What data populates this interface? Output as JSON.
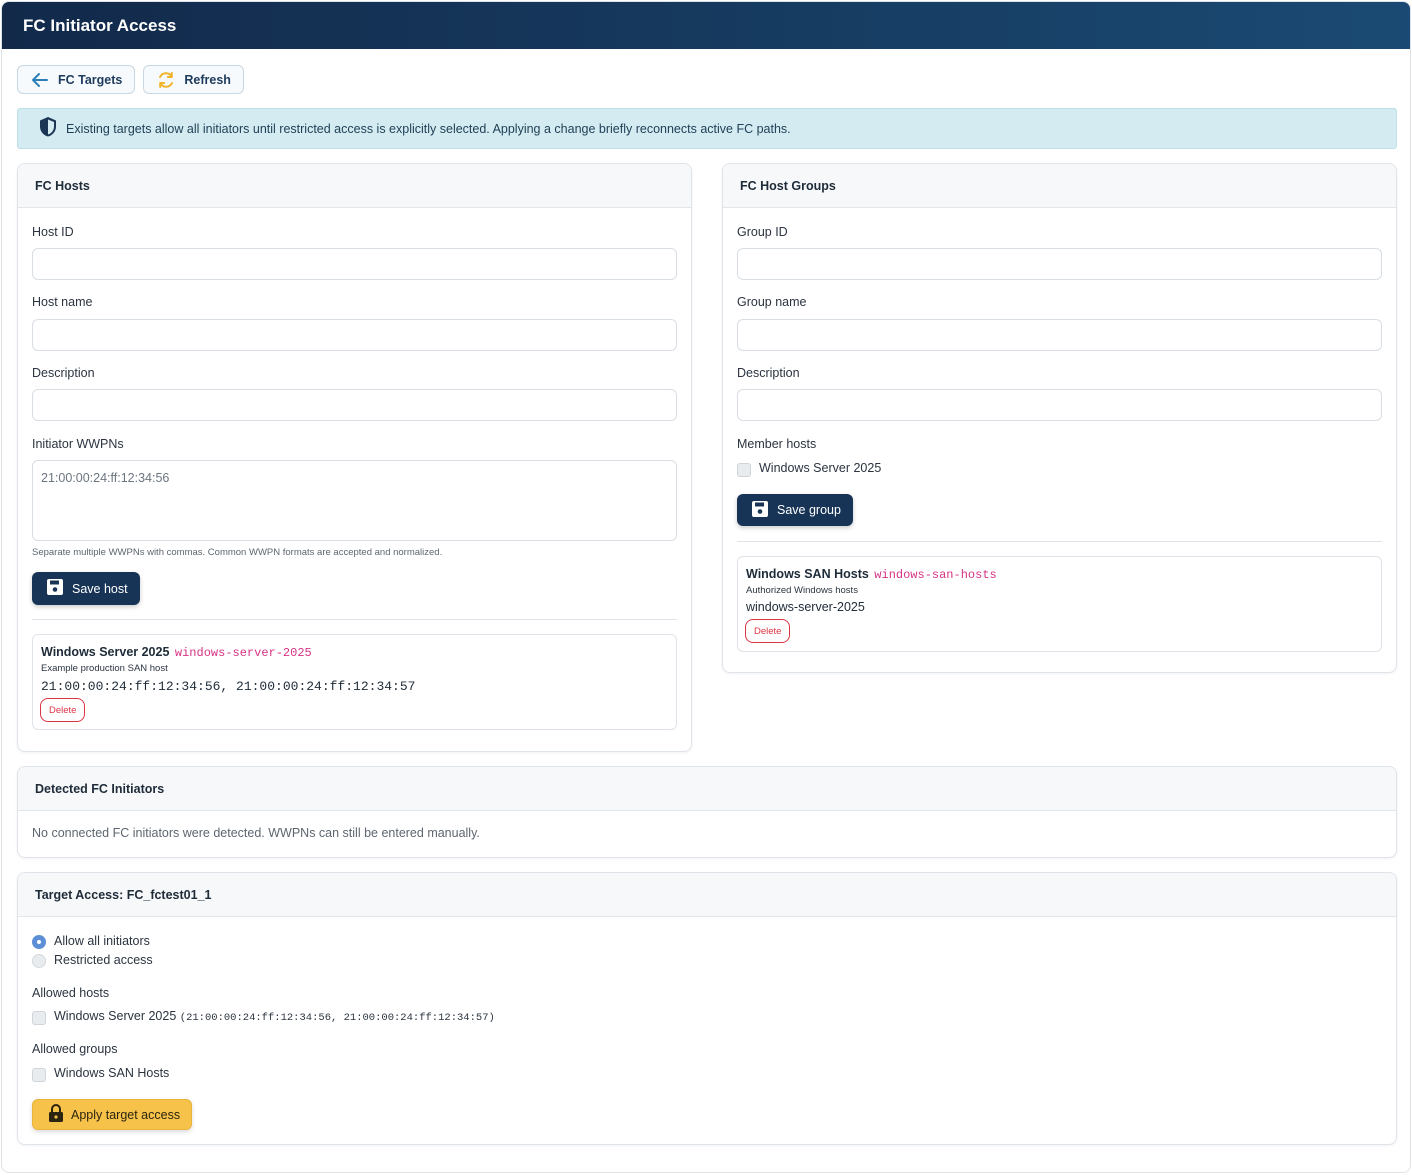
{
  "window": {
    "title": "FC Initiator Access"
  },
  "toolbar": {
    "back_label": "FC Targets",
    "refresh_label": "Refresh"
  },
  "notice": {
    "text": "Existing targets allow all initiators until restricted access is explicitly selected. Applying a change briefly reconnects active FC paths."
  },
  "hosts_card": {
    "title": "FC Hosts",
    "host_id_label": "Host ID",
    "host_name_label": "Host name",
    "description_label": "Description",
    "wwpns_label": "Initiator WWPNs",
    "wwpns_placeholder": "21:00:00:24:ff:12:34:56",
    "wwpns_hint": "Separate multiple WWPNs with commas. Common WWPN formats are accepted and normalized.",
    "save_label": "Save host",
    "host": {
      "name": "Windows Server 2025",
      "id": "windows-server-2025",
      "description": "Example production SAN host",
      "wwpns": "21:00:00:24:ff:12:34:56, 21:00:00:24:ff:12:34:57",
      "delete_label": "Delete"
    }
  },
  "groups_card": {
    "title": "FC Host Groups",
    "group_id_label": "Group ID",
    "group_name_label": "Group name",
    "description_label": "Description",
    "members_label": "Member hosts",
    "member_option": "Windows Server 2025",
    "save_label": "Save group",
    "group": {
      "name": "Windows SAN Hosts",
      "id": "windows-san-hosts",
      "description": "Authorized Windows hosts",
      "members": "windows-server-2025",
      "delete_label": "Delete"
    }
  },
  "detected_card": {
    "title": "Detected FC Initiators",
    "message": "No connected FC initiators were detected. WWPNs can still be entered manually."
  },
  "access_card": {
    "title": "Target Access: FC_fctest01_1",
    "option_all": "Allow all initiators",
    "option_restricted": "Restricted access",
    "selected": "Allow all initiators",
    "allowed_hosts_label": "Allowed hosts",
    "host_option": "Windows Server 2025",
    "host_option_wwpns": "(21:00:00:24:ff:12:34:56, 21:00:00:24:ff:12:34:57)",
    "allowed_groups_label": "Allowed groups",
    "group_option": "Windows SAN Hosts",
    "apply_label": "Apply target access"
  },
  "colors": {
    "header_start": "#12294a",
    "header_end": "#1a4a73",
    "primary": "#173457",
    "danger": "#dc3545",
    "warning": "#f7c24a",
    "info_bg": "#d3ebf1",
    "code": "#d63384"
  }
}
